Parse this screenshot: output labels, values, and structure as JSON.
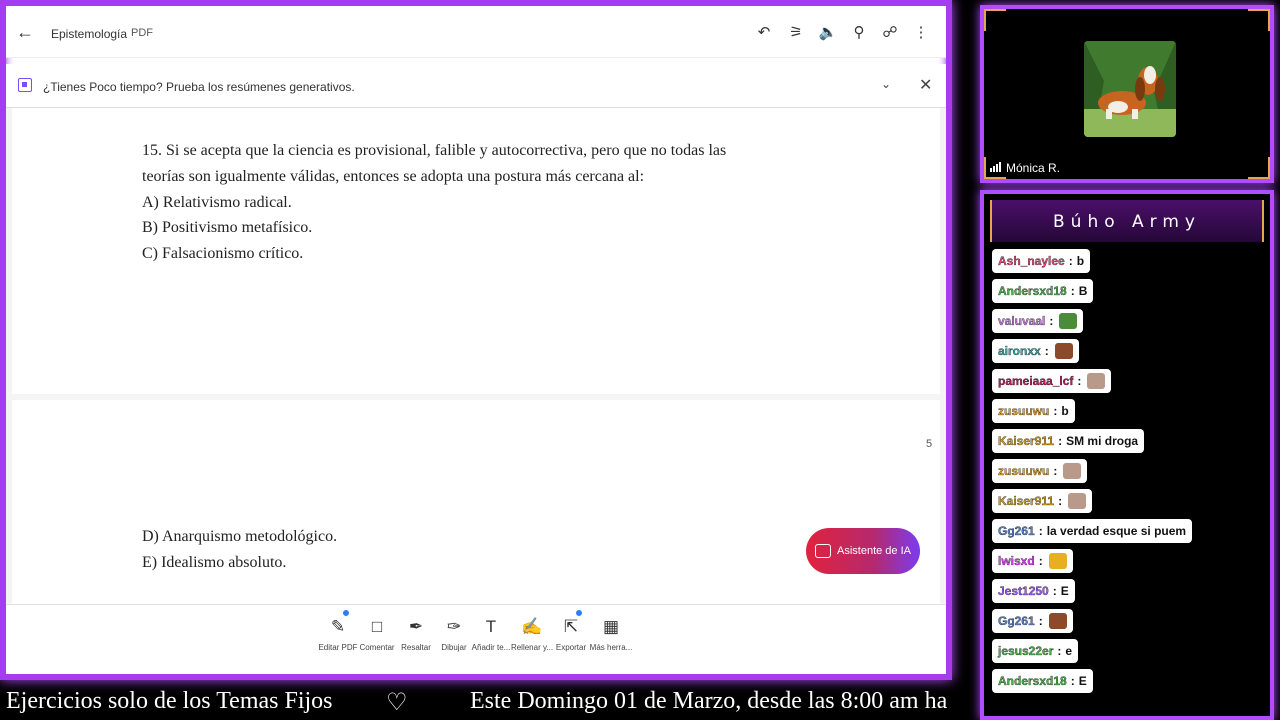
{
  "viewer": {
    "doc_title": "Epistemología",
    "doc_type": "PDF",
    "banner_text": "¿Tienes Poco tiempo? Prueba los resúmenes generativos.",
    "question_lines": [
      "15. Si se acepta que la ciencia es provisional, falible y autocorrectiva, pero que no todas las",
      "teorías son igualmente válidas, entonces se adopta una postura más cercana al:",
      "A) Relativismo radical.",
      "B) Positivismo metafísico.",
      "C) Falsacionismo crítico."
    ],
    "continued_lines": [
      "D) Anarquismo metodológico.",
      "E) Idealismo absoluto."
    ],
    "page_number": "5",
    "ai_button": "Asistente de IA",
    "tools": [
      {
        "label": "Editar PDF",
        "icon": "edit-pdf-icon"
      },
      {
        "label": "Comentar",
        "icon": "comment-icon"
      },
      {
        "label": "Resaltar",
        "icon": "highlight-icon"
      },
      {
        "label": "Dibujar",
        "icon": "draw-icon"
      },
      {
        "label": "Añadir te...",
        "icon": "add-text-icon"
      },
      {
        "label": "Rellenar y...",
        "icon": "fill-sign-icon"
      },
      {
        "label": "Exportar",
        "icon": "export-icon"
      },
      {
        "label": "Más herra...",
        "icon": "more-tools-icon"
      }
    ]
  },
  "webcam": {
    "name": "Mónica R."
  },
  "chat": {
    "title": "Búho Army",
    "messages": [
      {
        "user": "Ash_naylee",
        "color": "#e94a7a",
        "text": "b"
      },
      {
        "user": "Andersxd18",
        "color": "#4caf50",
        "text": "B"
      },
      {
        "user": "valuvaal",
        "color": "#c07fd6",
        "text": "",
        "emote": "frog-emote"
      },
      {
        "user": "aironxx",
        "color": "#3fa7a7",
        "text": "",
        "emote": "face-emote"
      },
      {
        "user": "pameiaaa_lcf",
        "color": "#c2185b",
        "text": "",
        "emote": "cat-emote"
      },
      {
        "user": "zusuuwu",
        "color": "#e0a030",
        "text": "b"
      },
      {
        "user": "Kaiser911",
        "color": "#d4a020",
        "text": "SM mi droga"
      },
      {
        "user": "zusuuwu",
        "color": "#e0a030",
        "text": "",
        "emote": "cat-emote"
      },
      {
        "user": "Kaiser911",
        "color": "#d4a020",
        "text": "",
        "emote": "cat-emote"
      },
      {
        "user": "Gg261",
        "color": "#5b7fc4",
        "text": "la verdad esque si puem"
      },
      {
        "user": "lwisxd",
        "color": "#e040fb",
        "text": "",
        "emote": "star-emote"
      },
      {
        "user": "Jest1250",
        "color": "#9c5cff",
        "text": "E"
      },
      {
        "user": "Gg261",
        "color": "#5b7fc4",
        "text": "",
        "emote": "face-emote"
      },
      {
        "user": "jesus22er",
        "color": "#4caf50",
        "text": "e"
      },
      {
        "user": "Andersxd18",
        "color": "#4caf50",
        "text": "E"
      }
    ]
  },
  "marquee": {
    "left_text": "Ejercicios solo de los Temas Fijos",
    "heart": "♡",
    "right_text": "Este Domingo 01 de Marzo, desde las 8:00 am ha"
  }
}
